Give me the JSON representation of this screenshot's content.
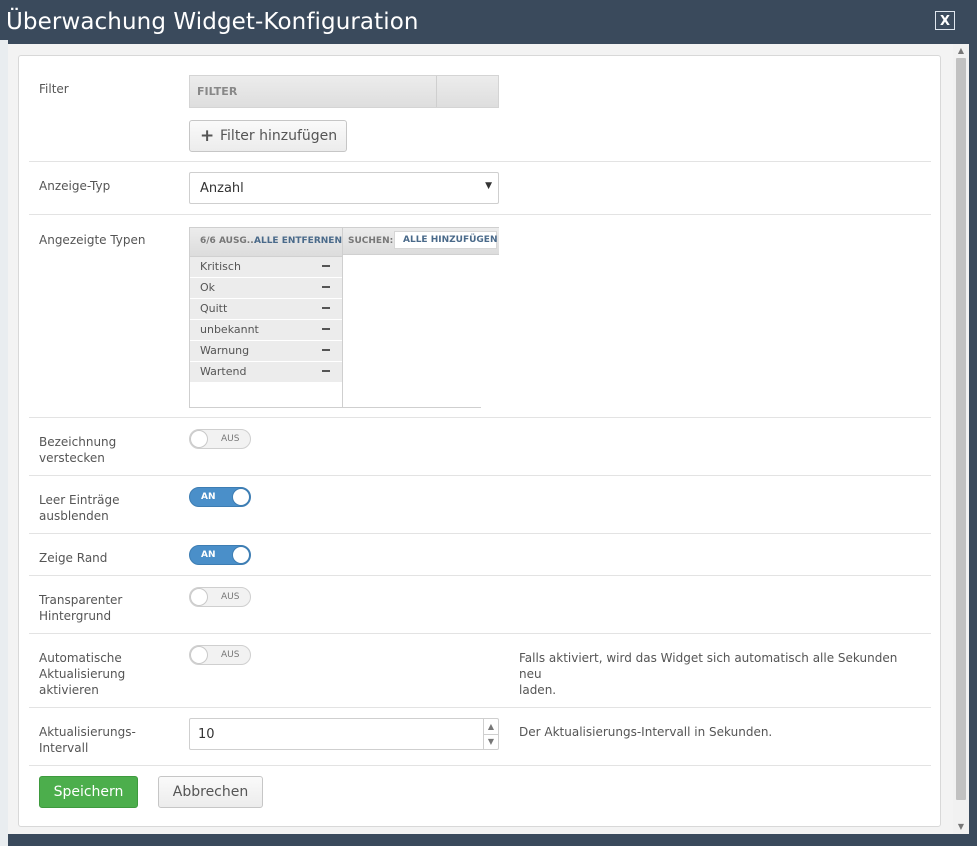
{
  "dialog": {
    "title": "Überwachung Widget-Konfiguration",
    "close_label": "X"
  },
  "filter": {
    "label": "Filter",
    "column_header": "FILTER",
    "add_button": "Filter hinzufügen",
    "add_icon": "plus-icon"
  },
  "display_type": {
    "label": "Anzeige-Typ",
    "selected": "Anzahl"
  },
  "shown_types": {
    "label": "Angezeigte Typen",
    "count_label": "6/6 AUSG...",
    "remove_all": "ALLE ENTFERNEN",
    "search_label": "SUCHEN:",
    "add_all": "ALLE HINZUFÜGEN",
    "items": [
      "Kritisch",
      "Ok",
      "Quitt",
      "unbekannt",
      "Warnung",
      "Wartend"
    ]
  },
  "toggles": {
    "hide_label": {
      "label_line1": "Bezeichnung",
      "label_line2": "verstecken",
      "state": "AUS"
    },
    "hide_empty": {
      "label_line1": "Leer Einträge",
      "label_line2": "ausblenden",
      "state": "AN"
    },
    "show_border": {
      "label": "Zeige Rand",
      "state": "AN"
    },
    "transparent_bg": {
      "label_line1": "Transparenter",
      "label_line2": "Hintergrund",
      "state": "AUS"
    },
    "auto_refresh": {
      "label_line1": "Automatische",
      "label_line2": "Aktualisierung",
      "label_line3": "aktivieren",
      "state": "AUS",
      "help_line1": "Falls aktiviert, wird das Widget sich automatisch alle Sekunden neu",
      "help_line2": "laden."
    }
  },
  "interval": {
    "label_line1": "Aktualisierungs-",
    "label_line2": "Intervall",
    "value": "10",
    "help": "Der Aktualisierungs-Intervall in Sekunden."
  },
  "actions": {
    "save": "Speichern",
    "cancel": "Abbrechen"
  },
  "colors": {
    "save_button": "#4cae4c",
    "toggle_on": "#4a8fc9",
    "title_bar": "#3a4a5c"
  }
}
